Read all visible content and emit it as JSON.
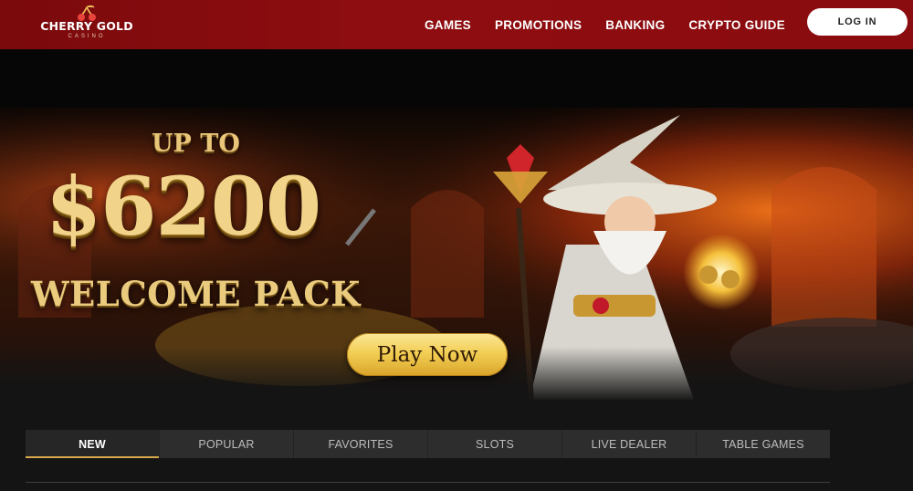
{
  "header": {
    "logo": {
      "name": "CHERRY GOLD",
      "sub": "CASINO",
      "icon": "cherry-icon"
    },
    "nav": [
      "GAMES",
      "PROMOTIONS",
      "BANKING",
      "CRYPTO GUIDE"
    ],
    "login_label": "LOG IN"
  },
  "hero": {
    "line1": "UP TO",
    "amount": "$6200",
    "line3": "WELCOME PACK",
    "cta": "Play Now",
    "character": "wizard-with-golden-cherry-orb"
  },
  "tabs": [
    {
      "label": "NEW",
      "active": true
    },
    {
      "label": "POPULAR"
    },
    {
      "label": "FAVORITES"
    },
    {
      "label": "SLOTS"
    },
    {
      "label": "LIVE DEALER"
    },
    {
      "label": "TABLE GAMES"
    }
  ],
  "colors": {
    "header_red": "#8e0d10",
    "gold": "#f3cf55",
    "tab_bar": "#2d2d2d",
    "tab_active_underline": "#d9a84a"
  }
}
